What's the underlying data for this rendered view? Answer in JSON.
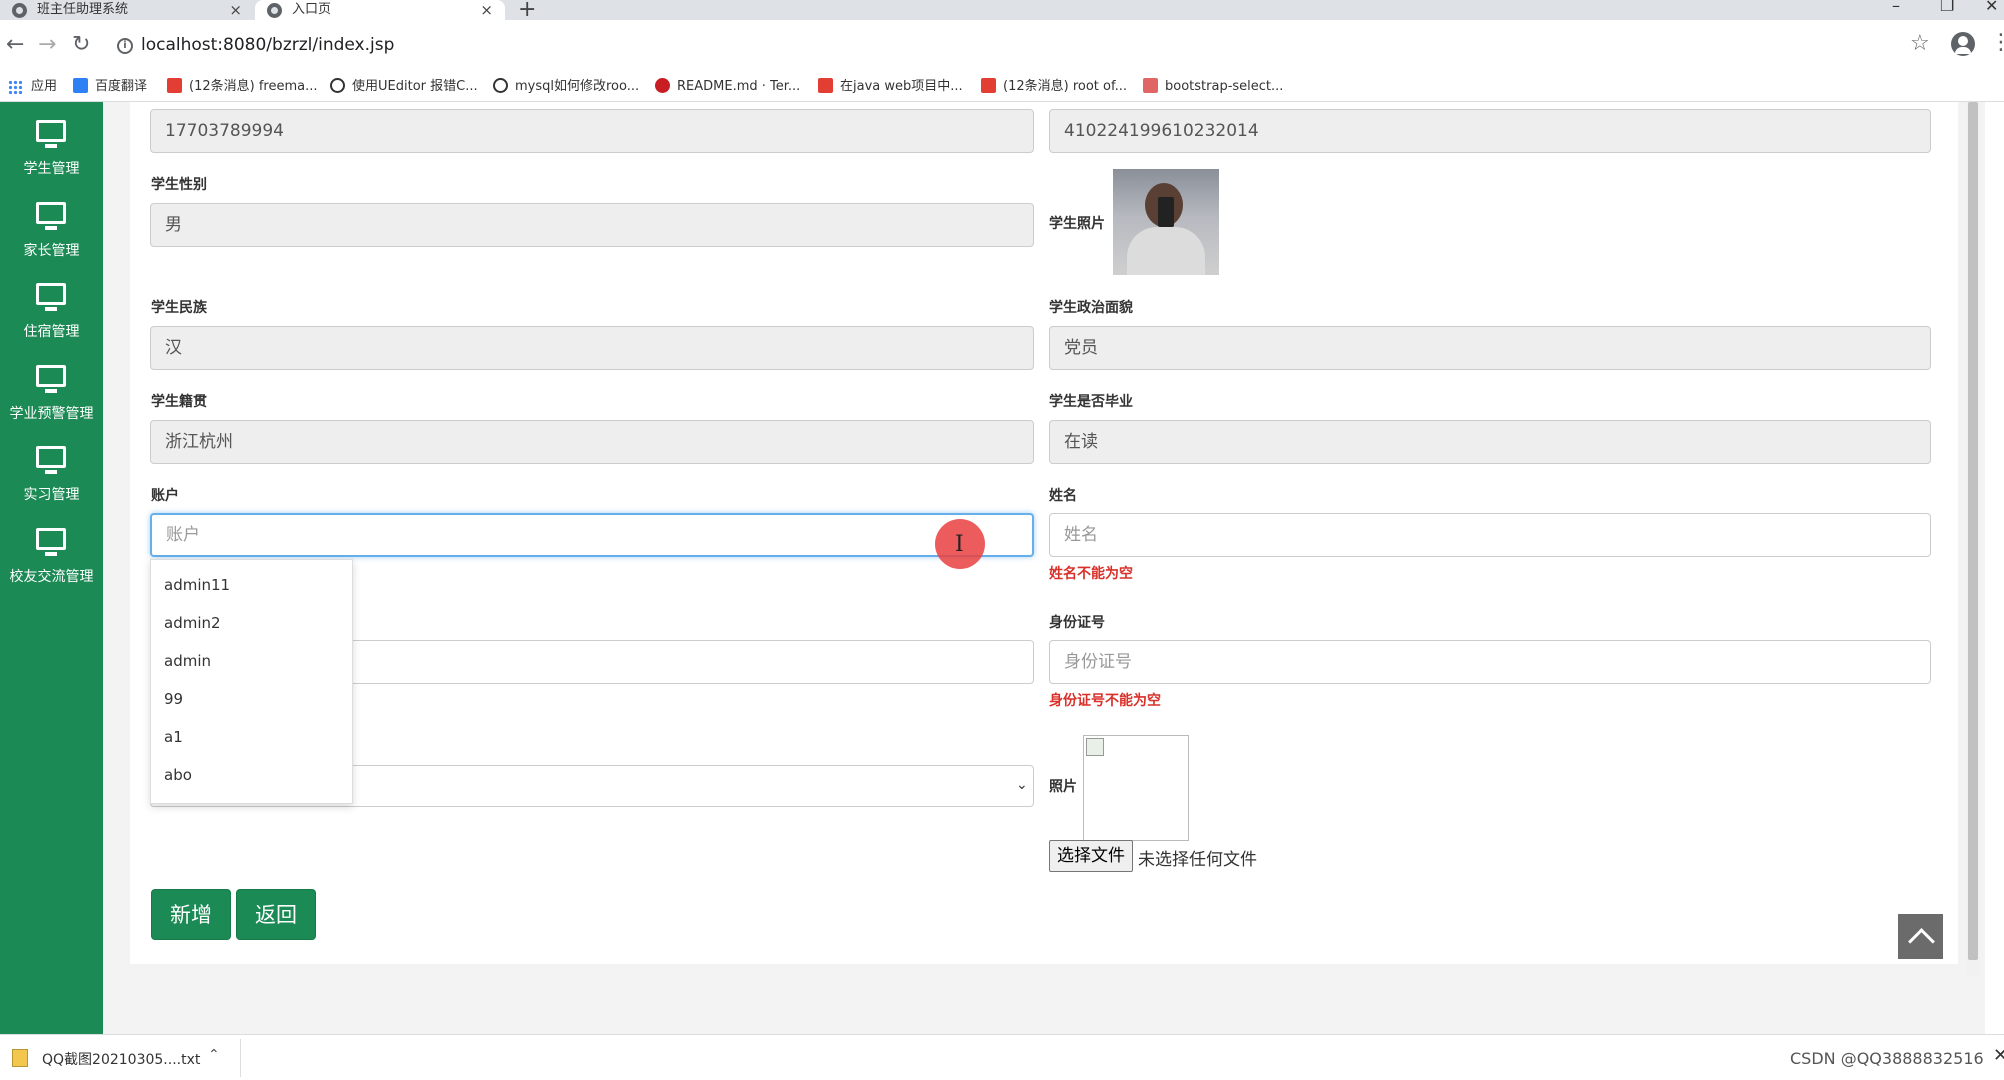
{
  "browser": {
    "tabs": [
      {
        "label": "班主任助理系统"
      },
      {
        "label": "入口页"
      }
    ],
    "url": "localhost:8080/bzrzl/index.jsp",
    "bookmarks": [
      {
        "label": "应用",
        "icon": "apps-icon",
        "color": "#4285f4"
      },
      {
        "label": "百度翻译",
        "icon": "baidu-translate-icon",
        "color": "#2f7ff5"
      },
      {
        "label": "(12条消息) freema...",
        "icon": "csdn-icon",
        "color": "#e33e33"
      },
      {
        "label": "使用UEditor 报错C...",
        "icon": "github-icon",
        "color": "#333333"
      },
      {
        "label": "mysql如何修改roo...",
        "icon": "github-icon",
        "color": "#333333"
      },
      {
        "label": "README.md · Ter...",
        "icon": "gitee-icon",
        "color": "#c71d23"
      },
      {
        "label": "在java web项目中...",
        "icon": "csdn-icon",
        "color": "#e33e33"
      },
      {
        "label": "(12条消息) root of...",
        "icon": "csdn-icon",
        "color": "#e33e33"
      },
      {
        "label": "bootstrap-select...",
        "icon": "doc-icon",
        "color": "#e06666"
      }
    ]
  },
  "sidebar": {
    "items": [
      {
        "label": "学生管理"
      },
      {
        "label": "家长管理"
      },
      {
        "label": "住宿管理"
      },
      {
        "label": "学业预警管理"
      },
      {
        "label": "实习管理"
      },
      {
        "label": "校友交流管理"
      }
    ]
  },
  "student": {
    "phone_value": "17703789994",
    "id_value": "410224199610232014",
    "gender_label": "学生性别",
    "gender_value": "男",
    "photo_label": "学生照片",
    "ethnicity_label": "学生民族",
    "ethnicity_value": "汉",
    "politics_label": "学生政治面貌",
    "politics_value": "党员",
    "hometown_label": "学生籍贯",
    "hometown_value": "浙江杭州",
    "graduated_label": "学生是否毕业",
    "graduated_value": "在读"
  },
  "form": {
    "account_label": "账户",
    "account_placeholder": "账户",
    "name_label": "姓名",
    "name_placeholder": "姓名",
    "name_error": "姓名不能为空",
    "idcard_label": "身份证号",
    "idcard_placeholder": "身份证号",
    "idcard_error": "身份证号不能为空",
    "photo_label": "照片",
    "file_button": "选择文件",
    "file_status": "未选择任何文件",
    "account_suggestions": [
      "admin11",
      "admin2",
      "admin",
      "99",
      "a1",
      "abo"
    ],
    "add_button": "新增",
    "back_button": "返回"
  },
  "downloads": {
    "file_name": "QQ截图20210305....txt"
  },
  "watermark": "CSDN @QQ3888832516",
  "colors": {
    "sidebar": "#1b8a55",
    "button": "#1b8a55",
    "error": "#d9302a",
    "focus": "#66afe9"
  }
}
